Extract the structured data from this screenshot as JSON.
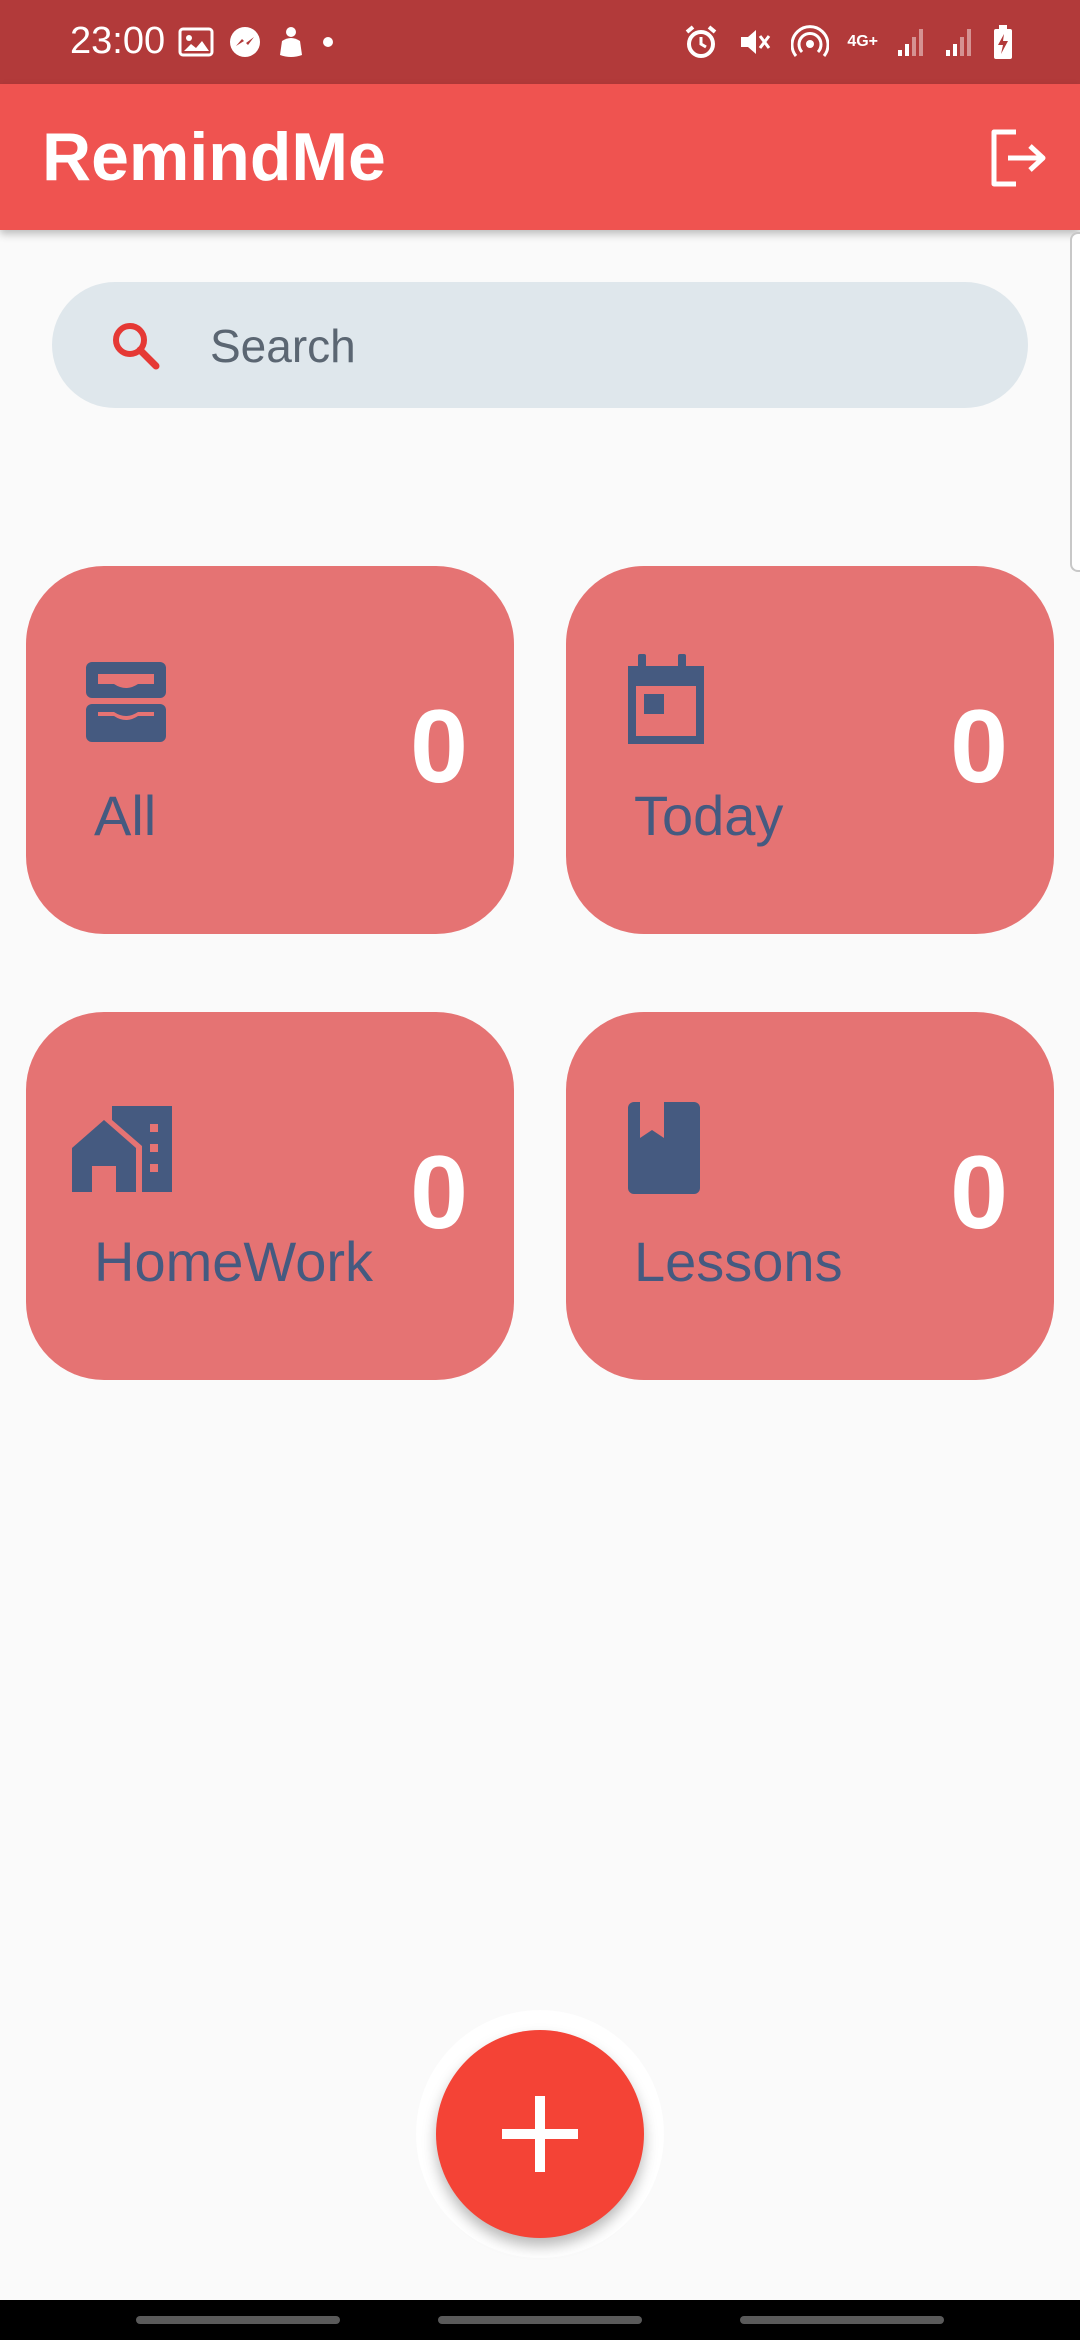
{
  "status_bar": {
    "time": "23:00",
    "network_label": "4G+",
    "left_icons": [
      "gallery-notification-icon",
      "messenger-icon",
      "app-notification-icon",
      "dot-icon"
    ],
    "right_icons": [
      "alarm-icon",
      "mute-icon",
      "hotspot-icon",
      "network-icon",
      "signal-icon",
      "signal-icon",
      "battery-charging-icon"
    ]
  },
  "app_bar": {
    "title": "RemindMe",
    "logout_icon": "logout-icon"
  },
  "search": {
    "placeholder": "Search",
    "value": ""
  },
  "cards": [
    {
      "label": "All",
      "count": "0",
      "icon": "inbox-tray-icon"
    },
    {
      "label": "Today",
      "count": "0",
      "icon": "calendar-today-icon"
    },
    {
      "label": "HomeWork",
      "count": "0",
      "icon": "home-work-icon"
    },
    {
      "label": "Lessons",
      "count": "0",
      "icon": "book-icon"
    }
  ],
  "fab": {
    "icon": "add-icon"
  },
  "colors": {
    "status_bar": "#b23a3a",
    "app_bar": "#ef5350",
    "card": "#e57373",
    "card_text": "#455a80",
    "fab": "#f44336",
    "search_bg": "#dfe7ec",
    "background": "#fafafa"
  }
}
